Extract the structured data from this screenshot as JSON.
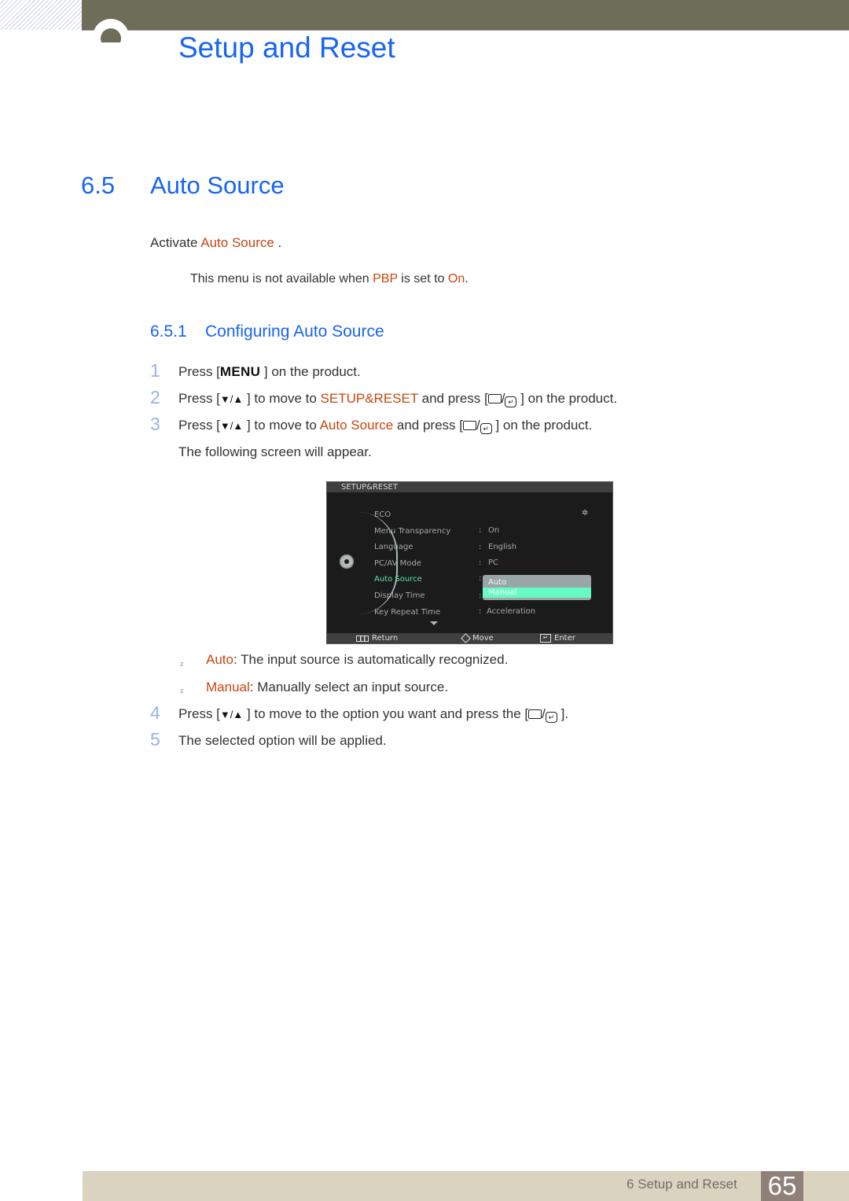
{
  "header": {
    "chapter_title": "Setup and Reset"
  },
  "section": {
    "number": "6.5",
    "title": "Auto Source",
    "intro_prefix": "Activate ",
    "intro_highlight": "Auto Source",
    "intro_suffix": " .",
    "note_prefix": "This menu is not available when ",
    "note_highlight1": "PBP",
    "note_middle": " is set to ",
    "note_highlight2": "On",
    "note_suffix": "."
  },
  "subsection": {
    "number": "6.5.1",
    "title": "Configuring Auto Source"
  },
  "steps": [
    {
      "num": "1",
      "prefix": "Press [",
      "key": "MENU",
      "suffix": " ] on the product."
    },
    {
      "num": "2",
      "prefix": "Press [",
      "arrows": "▼/▲",
      "mid": " ] to move to ",
      "highlight": "SETUP&RESET",
      "mid2": " and press [",
      "suffix": " ] on the product."
    },
    {
      "num": "3",
      "prefix": "Press [",
      "arrows": "▼/▲",
      "mid": " ] to move to ",
      "highlight": "Auto Source",
      "mid2": "  and press [",
      "suffix": " ] on the product."
    },
    {
      "num": "4",
      "prefix": "Press [",
      "arrows": "▼/▲",
      "mid": " ] to move to the option you want and press the [",
      "suffix": " ]."
    },
    {
      "num": "5",
      "text": "The selected option will be applied."
    }
  ],
  "following_text": "The following screen will appear.",
  "osd": {
    "title": "SETUP&RESET",
    "items": [
      {
        "label": "ECO",
        "value": ""
      },
      {
        "label": "Menu Transparency",
        "value": "On"
      },
      {
        "label": "Language",
        "value": "English"
      },
      {
        "label": "PC/AV Mode",
        "value": "PC"
      },
      {
        "label": "Auto Source",
        "value": "",
        "active": true
      },
      {
        "label": "Display Time",
        "value": ""
      },
      {
        "label": "Key Repeat Time",
        "value": "Acceleration"
      }
    ],
    "dropdown_options": [
      "Auto",
      "Manual"
    ],
    "dropdown_selected": "Manual",
    "footer": {
      "return": "Return",
      "move": "Move",
      "enter": "Enter"
    },
    "colors": {
      "active_item": "#5de3a8",
      "selected_option": "#66fbc2"
    }
  },
  "options": [
    {
      "name": "Auto",
      "desc": ": The input source is automatically recognized."
    },
    {
      "name": "Manual",
      "desc": ": Manually select an input source."
    }
  ],
  "footer": {
    "label": "6 Setup and Reset",
    "page": "65"
  },
  "colors": {
    "heading_blue": "#1764f5",
    "highlight_orange": "#c8450f",
    "step_number": "#9ab2ea",
    "topbar": "#6e6d5a",
    "footer_bar": "#dad3c0",
    "page_badge": "#8f8179"
  }
}
